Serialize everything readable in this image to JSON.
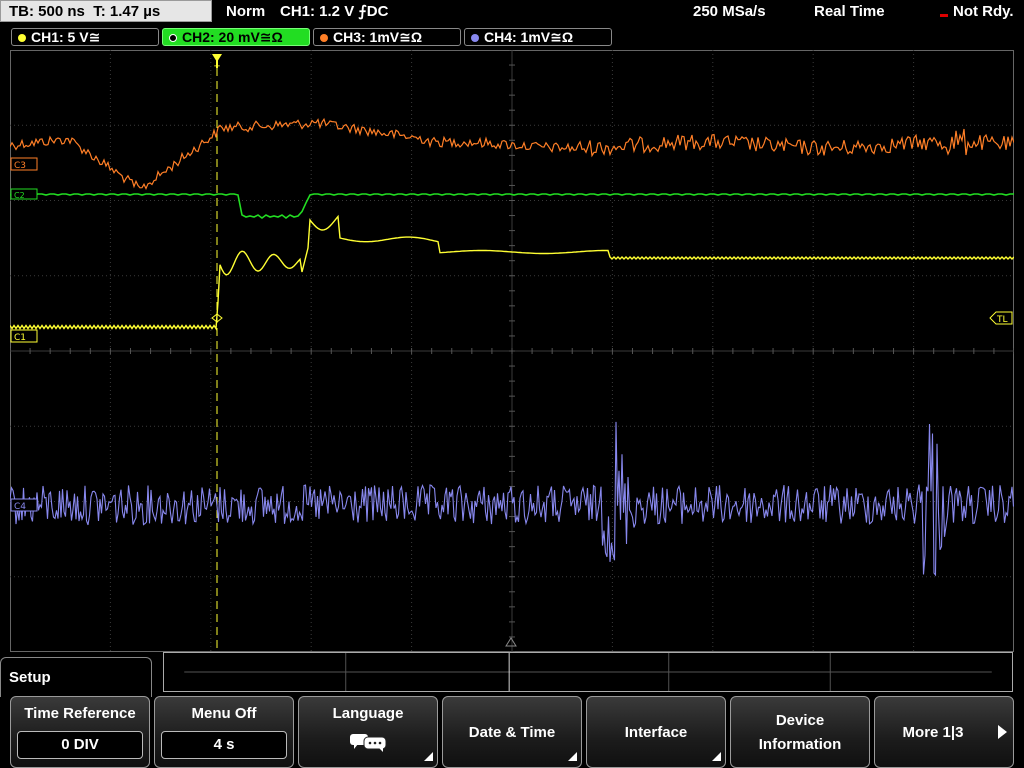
{
  "status": {
    "timebase": "TB: 500 ns",
    "trigger_time": "T: 1.47 µs",
    "mode": "Norm",
    "trigger_info": "CH1: 1.2 V ⨍DC",
    "sample_rate": "250 MSa/s",
    "acq_mode": "Real Time",
    "state": "Not Rdy."
  },
  "channels": [
    {
      "label": "CH1: 5 V≅",
      "color": "#ffff33"
    },
    {
      "label": "CH2: 20 mV≅Ω",
      "color": "#22dd22"
    },
    {
      "label": "CH3: 1mV≅Ω",
      "color": "#ff7f27"
    },
    {
      "label": "CH4: 1mV≅Ω",
      "color": "#8888ee"
    }
  ],
  "markers": {
    "c3": "C3",
    "c2": "C2",
    "c1": "C1",
    "c4": "C4",
    "tl": "TL",
    "trigger": "T"
  },
  "menu": {
    "title": "Setup",
    "softkeys": [
      {
        "label": "Time Reference",
        "value": "0 DIV"
      },
      {
        "label": "Menu Off",
        "value": "4 s"
      },
      {
        "label": "Language",
        "icon": "speech-bubbles-icon"
      },
      {
        "label": "Date & Time"
      },
      {
        "label": "Interface"
      },
      {
        "label_line1": "Device",
        "label_line2": "Information"
      },
      {
        "label": "More 1|3"
      }
    ]
  }
}
